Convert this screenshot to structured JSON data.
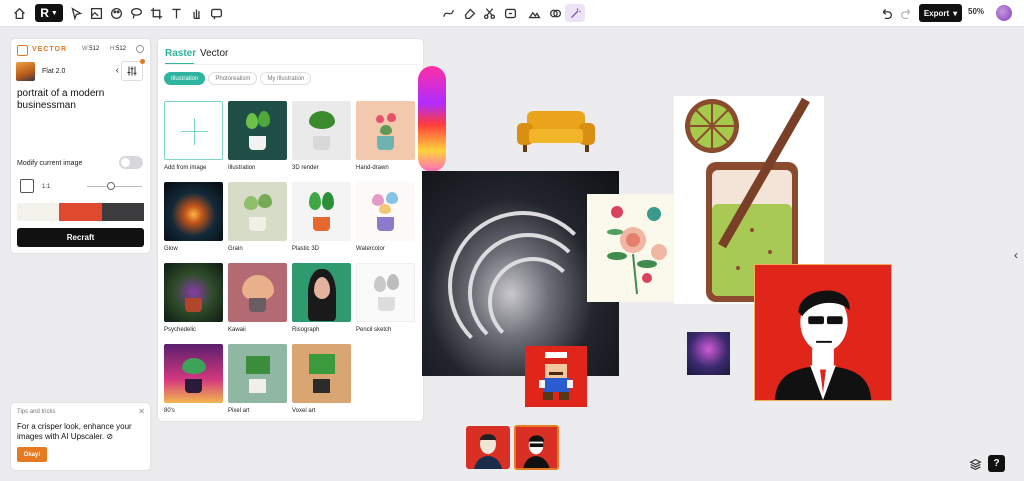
{
  "toolbar": {
    "logo_letter": "R",
    "export_label": "Export",
    "zoom_level": "50%",
    "accent_active": "#7a4fb3"
  },
  "settings_panel": {
    "model_label": "VECTOR",
    "width_label": "W:",
    "width_value": "512",
    "height_label": "H:",
    "height_value": "512",
    "style_name": "Flat 2.0",
    "prompt": "portrait of a modern businessman",
    "modify_label": "Modify current image",
    "modify_enabled": false,
    "aspect_ratio": "1:1",
    "palette": [
      "#f3f3ec",
      "#e0492e",
      "#3c3c3e"
    ],
    "generate_label": "Recraft"
  },
  "tips": {
    "title": "Tips and tricks",
    "text": "For a crisper look, enhance your images with AI Upscaler.",
    "button": "Okay!"
  },
  "style_picker": {
    "modes": [
      "Raster",
      "Vector"
    ],
    "active_mode": "Raster",
    "filters": [
      "Illustration",
      "Photorealism",
      "My Illustration"
    ],
    "active_filter": "Illustration",
    "styles": [
      "Add from image",
      "Illustration",
      "3D render",
      "Hand-drawn",
      "Glow",
      "Grain",
      "Plastic 3D",
      "Watercolor",
      "Psychedelic",
      "Kawaii",
      "Risograph",
      "Pencil sketch",
      "80's",
      "Pixel art",
      "Voxel art"
    ]
  },
  "help": {
    "label": "?"
  }
}
